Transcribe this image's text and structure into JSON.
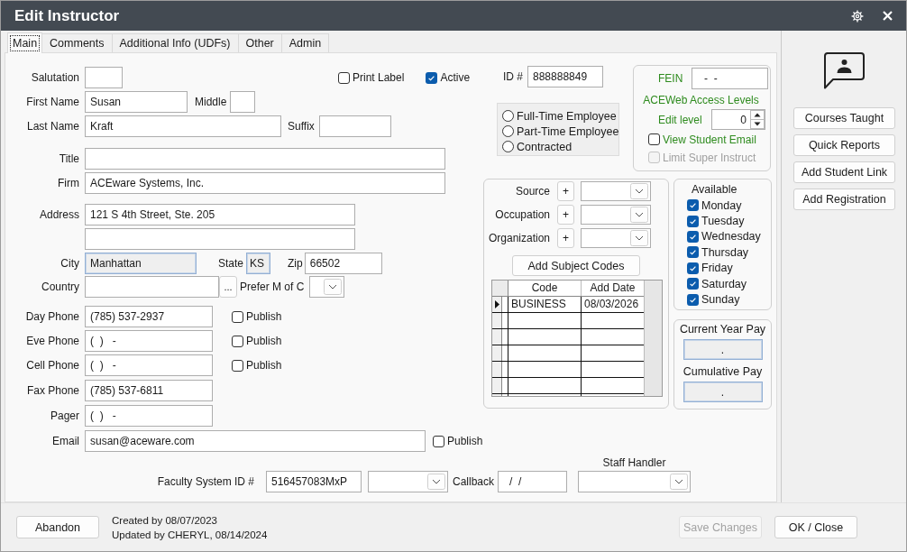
{
  "window": {
    "title": "Edit Instructor"
  },
  "tabs": [
    {
      "label": "Main",
      "selected": true
    },
    {
      "label": "Comments",
      "selected": false
    },
    {
      "label": "Additional Info (UDFs)",
      "selected": false
    },
    {
      "label": "Other",
      "selected": false
    },
    {
      "label": "Admin",
      "selected": false
    }
  ],
  "person": {
    "salutation": {
      "label": "Salutation"
    },
    "first_name": {
      "label": "First Name",
      "value": "Susan"
    },
    "middle": {
      "label": "Middle"
    },
    "last_name": {
      "label": "Last Name",
      "value": "Kraft"
    },
    "suffix": {
      "label": "Suffix"
    },
    "title": {
      "label": "Title"
    },
    "firm": {
      "label": "Firm",
      "value": "ACEware Systems, Inc."
    }
  },
  "flags": [
    {
      "label": "Print Label",
      "checked": false
    },
    {
      "label": "Active",
      "checked": true
    }
  ],
  "address": {
    "label": "Address",
    "line_1": "121 S 4th Street, Ste. 205",
    "city": {
      "label": "City",
      "value": "Manhattan",
      "readonly": true
    },
    "state": {
      "label": "State",
      "value": "KS",
      "readonly": true
    },
    "zip": {
      "label": "Zip",
      "value": "66502",
      "readonly": false
    },
    "country": {
      "label": "Country",
      "browse_button": "..."
    },
    "preferred_contact": {
      "label": "Prefer M of C"
    }
  },
  "phones": [
    {
      "label": "Day Phone",
      "value": "(785) 537-2937",
      "publish": {
        "label": "Publish",
        "checked": false
      }
    },
    {
      "label": "Eve Phone",
      "value": "(  )   -",
      "publish": {
        "label": "Publish",
        "checked": false
      }
    },
    {
      "label": "Cell Phone",
      "value": "(  )   -",
      "publish": {
        "label": "Publish",
        "checked": false
      }
    },
    {
      "label": "Fax Phone",
      "value": "(785) 537-6811"
    },
    {
      "label": "Pager",
      "value": "(  )   -"
    }
  ],
  "email": {
    "label": "Email",
    "value": "susan@aceware.com",
    "publish": {
      "label": "Publish",
      "checked": false
    }
  },
  "id": {
    "label": "ID #",
    "value": "888888849"
  },
  "employment": [
    {
      "label": "Full-Time Employee",
      "selected": false
    },
    {
      "label": "Part-Time Employee",
      "selected": false
    },
    {
      "label": "Contracted",
      "selected": false
    }
  ],
  "web_access": {
    "fein": {
      "label": "FEIN",
      "value": "-  -"
    },
    "heading": "ACEWeb Access Levels",
    "edit_level": {
      "label": "Edit level",
      "value": "0"
    },
    "options": [
      {
        "label": "View Student Email",
        "checked": false,
        "disabled": false
      },
      {
        "label": "Limit Super Instruct",
        "checked": false,
        "disabled": true
      }
    ]
  },
  "lookups": [
    {
      "label": "Source",
      "add_button": "+"
    },
    {
      "label": "Occupation",
      "add_button": "+"
    },
    {
      "label": "Organization",
      "add_button": "+"
    }
  ],
  "subject_codes": {
    "button": "Add Subject Codes",
    "columns": [
      "Code",
      "Add Date"
    ],
    "rows": [
      {
        "selected": true,
        "cells": [
          "BUSINESS",
          "08/03/2026"
        ]
      }
    ]
  },
  "availability": {
    "heading": "Available",
    "days": [
      {
        "label": "Monday",
        "checked": true
      },
      {
        "label": "Tuesday",
        "checked": true
      },
      {
        "label": "Wednesday",
        "checked": true
      },
      {
        "label": "Thursday",
        "checked": true
      },
      {
        "label": "Friday",
        "checked": true
      },
      {
        "label": "Saturday",
        "checked": true
      },
      {
        "label": "Sunday",
        "checked": true
      }
    ]
  },
  "pay": [
    {
      "label": "Current Year Pay",
      "value": ".",
      "readonly": true
    },
    {
      "label": "Cumulative Pay",
      "value": ".",
      "readonly": true
    }
  ],
  "faculty": {
    "system_id": {
      "label": "Faculty System ID #",
      "value": "516457083MxP"
    },
    "callback": {
      "label": "Callback",
      "value": "/  /"
    },
    "staff_handler": {
      "label": "Staff Handler"
    }
  },
  "side_actions": [
    "Courses Taught",
    "Quick Reports",
    "Add Student Link",
    "Add Registration"
  ],
  "footer": {
    "abandon": "Abandon",
    "audit": [
      "Created by 08/07/2023",
      "Updated by CHERYL, 08/14/2024"
    ],
    "actions": [
      {
        "label": "Save Changes",
        "disabled": true
      },
      {
        "label": "OK / Close",
        "disabled": false
      }
    ]
  }
}
